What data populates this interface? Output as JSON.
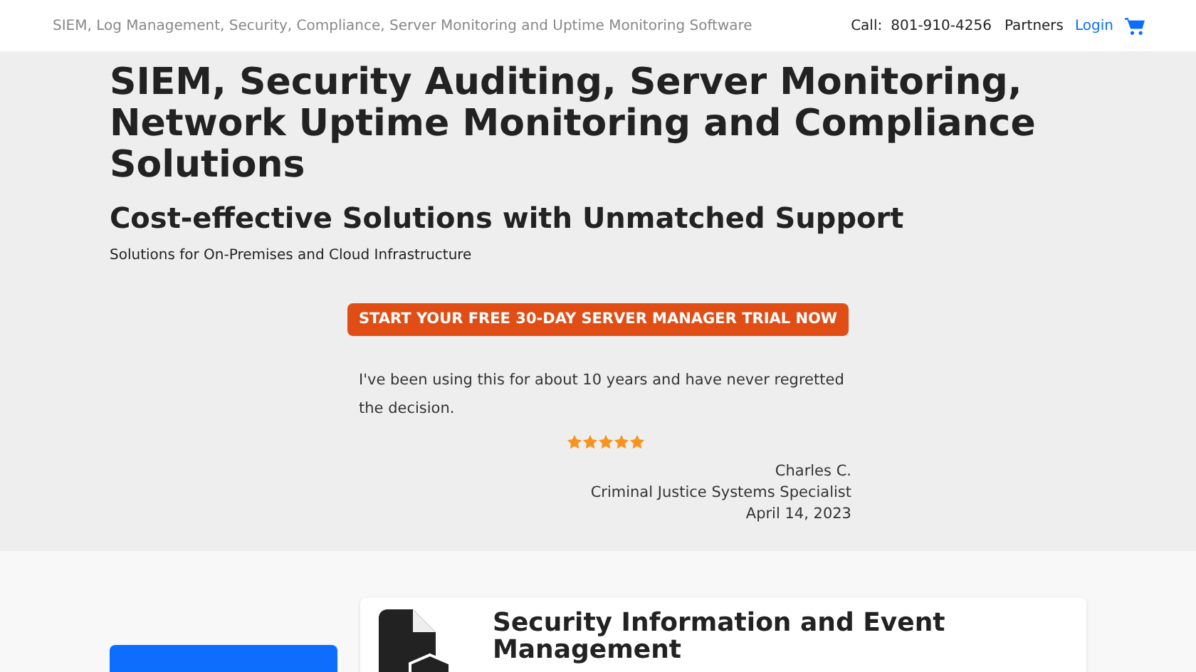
{
  "header": {
    "tagline": "SIEM, Log Management, Security, Compliance, Server Monitoring and Uptime Monitoring Software",
    "call_label": "Call:",
    "phone": "801-910-4256",
    "links": [
      {
        "label": "Partners",
        "kind": "plain"
      },
      {
        "label": "Login",
        "kind": "link"
      }
    ]
  },
  "hero": {
    "title": "SIEM, Security Auditing, Server Monitoring, Network Uptime Monitoring and Compliance Solutions",
    "subtitle": "Cost-effective Solutions with Unmatched Support",
    "description": "Solutions for On-Premises and Cloud Infrastructure",
    "cta": "START YOUR FREE 30-DAY SERVER MANAGER TRIAL NOW",
    "testimonial": {
      "quote": "I've been using this for about 10 years and have never regretted the decision.",
      "stars": 5,
      "author": "Charles C.",
      "role": "Criminal Justice Systems Specialist",
      "date": "April 14, 2023"
    }
  },
  "product": {
    "title": "Security Information and Event Management"
  }
}
